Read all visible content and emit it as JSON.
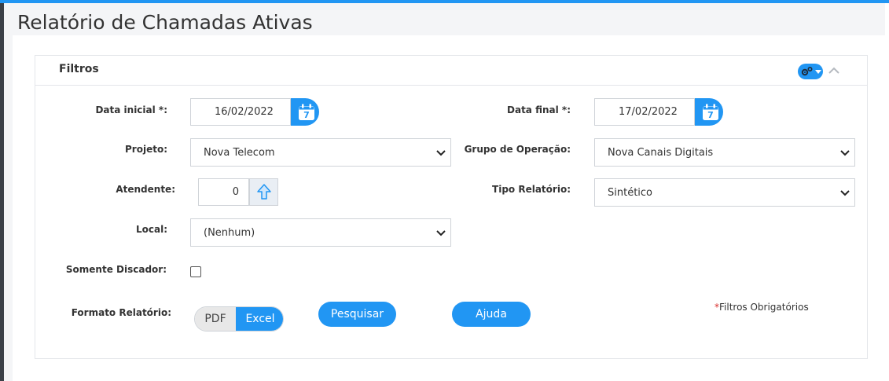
{
  "page": {
    "title": "Relatório de Chamadas Ativas"
  },
  "panel": {
    "title": "Filtros",
    "tools_icon": "gears-icon",
    "collapse_icon": "chevron-up-icon"
  },
  "fields": {
    "data_inicial": {
      "label": "Data inicial *:",
      "value": "16/02/2022",
      "icon": "calendar-icon"
    },
    "data_final": {
      "label": "Data final *:",
      "value": "17/02/2022",
      "icon": "calendar-icon"
    },
    "projeto": {
      "label": "Projeto:",
      "value": "Nova Telecom"
    },
    "grupo_operacao": {
      "label": "Grupo de Operação:",
      "value": "Nova Canais Digitais"
    },
    "atendente": {
      "label": "Atendente:",
      "value": "0",
      "icon": "arrow-up-icon"
    },
    "tipo_relatorio": {
      "label": "Tipo Relatório:",
      "value": "Sintético"
    },
    "local": {
      "label": "Local:",
      "value": "(Nenhum)"
    },
    "somente_discador": {
      "label": "Somente Discador:",
      "checked": false
    },
    "formato_relatorio": {
      "label": "Formato Relatório:",
      "options": [
        "PDF",
        "Excel"
      ],
      "selected": "Excel"
    }
  },
  "buttons": {
    "pesquisar": "Pesquisar",
    "ajuda": "Ajuda"
  },
  "required_note": {
    "star": "*",
    "text": "Filtros Obrigatórios"
  },
  "colors": {
    "accent": "#2196f3",
    "required": "#d9302e",
    "background": "#f4f5f7"
  }
}
